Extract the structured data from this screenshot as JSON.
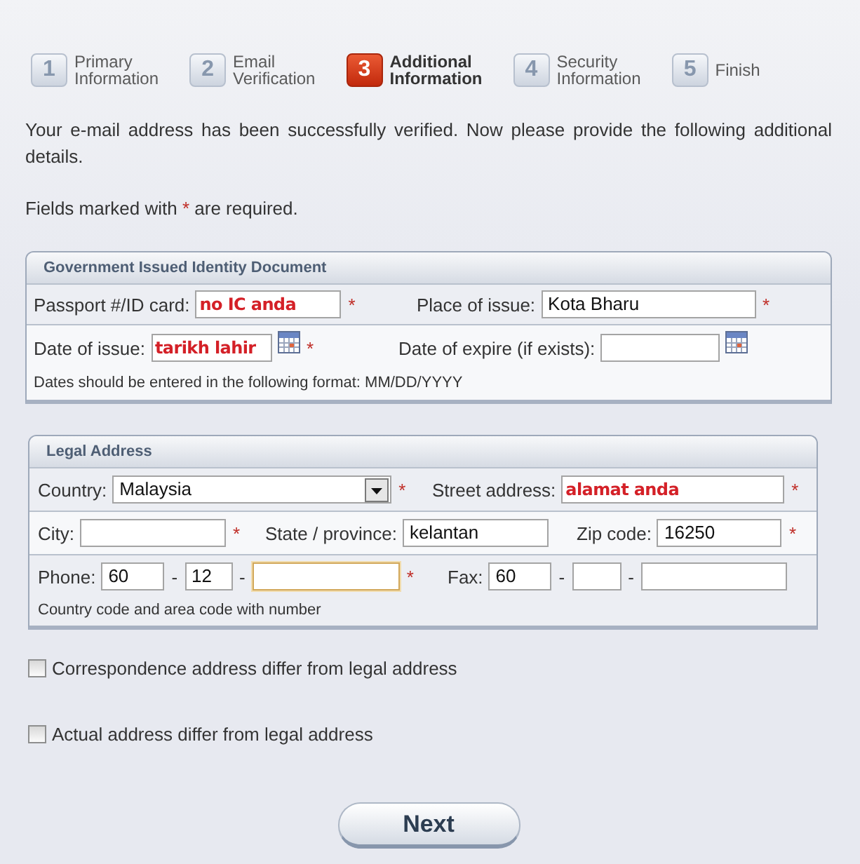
{
  "steps": [
    {
      "number": "1",
      "label": "Primary Information",
      "selected": false
    },
    {
      "number": "2",
      "label": "Email Verification",
      "selected": false
    },
    {
      "number": "3",
      "label": "Additional Information",
      "selected": true
    },
    {
      "number": "4",
      "label": "Security Information",
      "selected": false
    },
    {
      "number": "5",
      "label": "Finish",
      "selected": false
    }
  ],
  "intro": "Your e-mail address has been successfully verified. Now please provide the following additional details.",
  "required_note": {
    "before": "Fields marked with",
    "mark": "*",
    "after": "are required."
  },
  "sections": [
    {
      "title": "Government Issued Identity Document",
      "rows": [
        {
          "fields": [
            {
              "label": "Passport #/ID card:",
              "inputs": [
                {
                  "kind": "text",
                  "value": "no IC anda",
                  "annotation": true,
                  "focused": false
                }
              ],
              "required_mark": "*"
            },
            {
              "label": "Place of issue:",
              "inputs": [
                {
                  "kind": "text",
                  "value": "Kota Bharu",
                  "annotation": false,
                  "focused": false
                }
              ],
              "required_mark": "*"
            }
          ]
        },
        {
          "fields": [
            {
              "label": "Date of issue:",
              "inputs": [
                {
                  "kind": "date",
                  "value": "tarikh lahir",
                  "annotation": true,
                  "focused": false
                }
              ],
              "required_mark": "*"
            },
            {
              "label": "Date of expire (if exists):",
              "inputs": [
                {
                  "kind": "date",
                  "focused": false
                }
              ]
            }
          ],
          "hint": "Dates should be entered in the following format: MM/DD/YYYY"
        }
      ]
    },
    {
      "title": "Legal Address",
      "rows": [
        {
          "fields": [
            {
              "label": "Country:",
              "inputs": [
                {
                  "kind": "select",
                  "value": "Malaysia",
                  "annotation": false,
                  "focused": false
                }
              ],
              "required_mark": "*"
            },
            {
              "label": "Street address:",
              "inputs": [
                {
                  "kind": "text",
                  "value": "alamat anda",
                  "annotation": true,
                  "focused": false
                }
              ],
              "required_mark": "*"
            }
          ]
        },
        {
          "fields": [
            {
              "label": "City:",
              "inputs": [
                {
                  "kind": "text",
                  "focused": false
                }
              ],
              "required_mark": "*"
            },
            {
              "label": "State / province:",
              "inputs": [
                {
                  "kind": "text",
                  "value": "kelantan",
                  "annotation": false,
                  "focused": false
                }
              ]
            },
            {
              "label": "Zip code:",
              "inputs": [
                {
                  "kind": "text",
                  "value": "16250",
                  "annotation": false,
                  "focused": false
                }
              ],
              "required_mark": "*"
            }
          ]
        },
        {
          "fields": [
            {
              "label": "Phone:",
              "inputs": [
                {
                  "kind": "text",
                  "value": "60",
                  "annotation": false,
                  "focused": false
                },
                {
                  "kind": "separator",
                  "text": "-"
                },
                {
                  "kind": "text",
                  "value": "12",
                  "annotation": false,
                  "focused": false
                },
                {
                  "kind": "separator",
                  "text": "-"
                },
                {
                  "kind": "text",
                  "focused": true
                }
              ],
              "required_mark": "*"
            },
            {
              "label": "Fax:",
              "inputs": [
                {
                  "kind": "text",
                  "value": "60",
                  "annotation": false,
                  "focused": false
                },
                {
                  "kind": "separator",
                  "text": "-"
                },
                {
                  "kind": "text",
                  "focused": false
                },
                {
                  "kind": "separator",
                  "text": "-"
                },
                {
                  "kind": "text",
                  "focused": false
                }
              ]
            }
          ],
          "hint": "Country code and area code with number"
        }
      ]
    }
  ],
  "checkboxes": [
    {
      "label": "Correspondence address differ from legal address",
      "checked": false
    },
    {
      "label": "Actual address differ from legal address",
      "checked": false
    }
  ],
  "next_button": "Next"
}
